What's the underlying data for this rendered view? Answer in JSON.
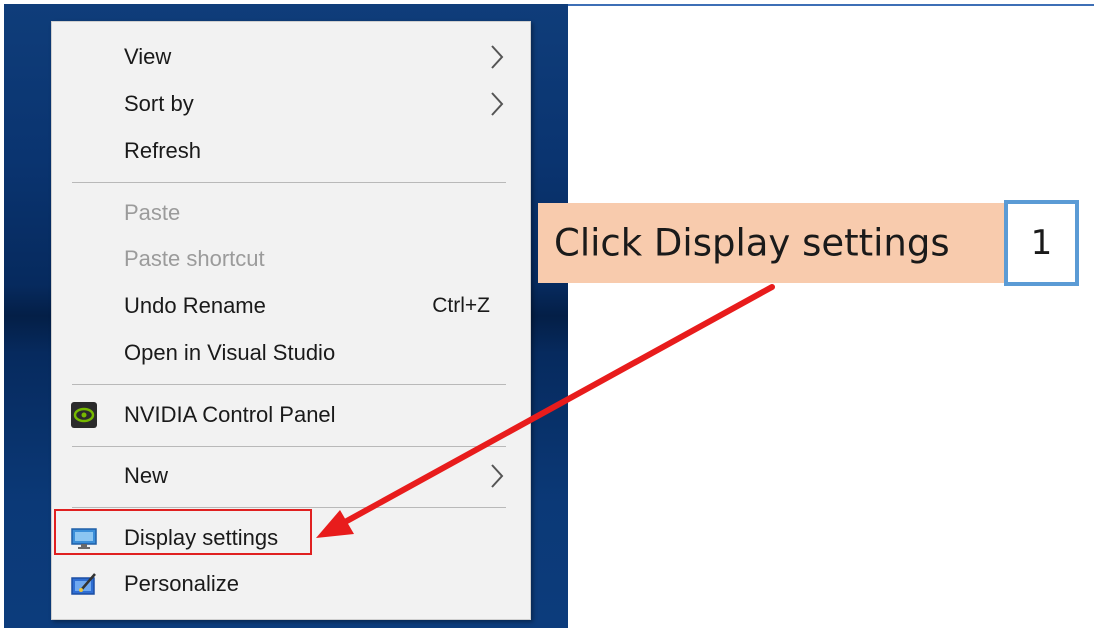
{
  "context_menu": {
    "items": [
      {
        "label": "View",
        "has_submenu": true,
        "enabled": true
      },
      {
        "label": "Sort by",
        "has_submenu": true,
        "enabled": true
      },
      {
        "label": "Refresh",
        "has_submenu": false,
        "enabled": true
      },
      {
        "label": "Paste",
        "has_submenu": false,
        "enabled": false
      },
      {
        "label": "Paste shortcut",
        "has_submenu": false,
        "enabled": false
      },
      {
        "label": "Undo Rename",
        "shortcut": "Ctrl+Z",
        "has_submenu": false,
        "enabled": true
      },
      {
        "label": "Open in Visual Studio",
        "has_submenu": false,
        "enabled": true
      },
      {
        "label": "NVIDIA Control Panel",
        "icon": "nvidia-icon",
        "has_submenu": false,
        "enabled": true
      },
      {
        "label": "New",
        "has_submenu": true,
        "enabled": true
      },
      {
        "label": "Display settings",
        "icon": "display-icon",
        "has_submenu": false,
        "enabled": true,
        "highlighted": true
      },
      {
        "label": "Personalize",
        "icon": "personalize-icon",
        "has_submenu": false,
        "enabled": true
      }
    ]
  },
  "annotation": {
    "callout_text": "Click Display settings",
    "step_number": "1",
    "callout_color": "#f8cbad",
    "step_border_color": "#5b9bd5",
    "arrow_color": "#e81c1c",
    "highlight_color": "#e02020"
  },
  "colors": {
    "desktop_background": "#0a3470",
    "menu_background": "#f2f2f2"
  }
}
